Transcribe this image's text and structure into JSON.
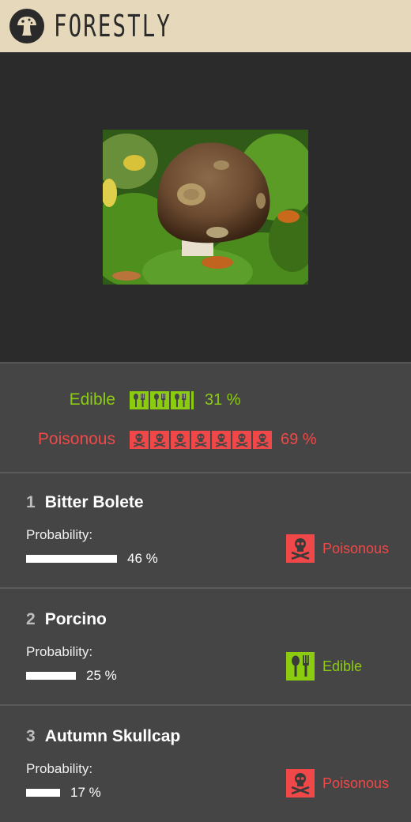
{
  "app": {
    "title": "FORESTLY",
    "logo_icon": "mushroom-logo-icon"
  },
  "photo": {
    "alt": "uploaded mushroom photo"
  },
  "summary": {
    "edible": {
      "label": "Edible",
      "percent": "31 %",
      "icon_count": 3,
      "icon": "fork-spoon-icon",
      "color": "#8ccc10"
    },
    "poisonous": {
      "label": "Poisonous",
      "percent": "69 %",
      "icon_count": 7,
      "icon": "skull-crossbones-icon",
      "color": "#f04848"
    }
  },
  "candidates": [
    {
      "rank": "1",
      "name": "Bitter Bolete",
      "probability_label": "Probability:",
      "probability_text": "46 %",
      "probability": 0.46,
      "status": "Poisonous",
      "status_type": "poisonous"
    },
    {
      "rank": "2",
      "name": "Porcino",
      "probability_label": "Probability:",
      "probability_text": "25 %",
      "probability": 0.25,
      "status": "Edible",
      "status_type": "edible"
    },
    {
      "rank": "3",
      "name": "Autumn Skullcap",
      "probability_label": "Probability:",
      "probability_text": "17 %",
      "probability": 0.17,
      "status": "Poisonous",
      "status_type": "poisonous"
    }
  ]
}
